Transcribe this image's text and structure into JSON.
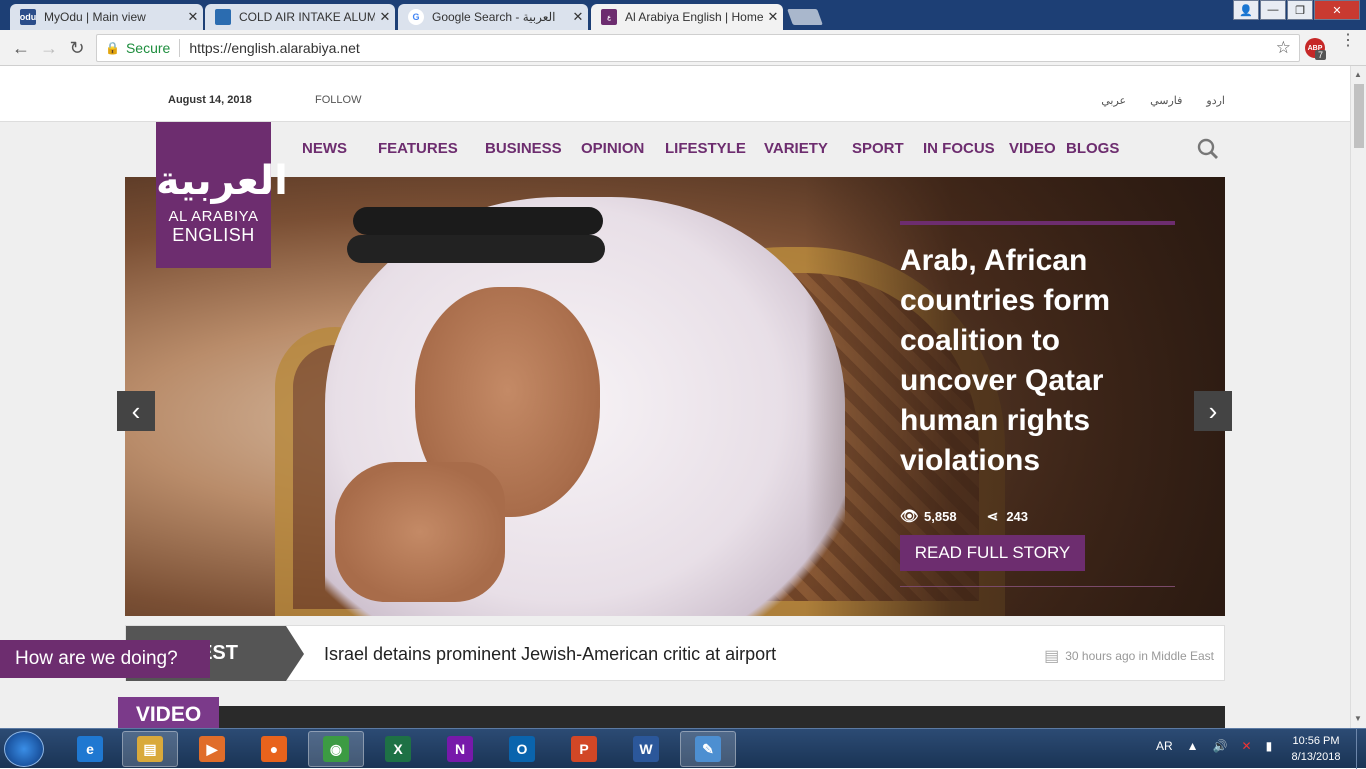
{
  "browser": {
    "tabs": [
      {
        "title": "MyOdu | Main view",
        "favicon": "odu",
        "active": false
      },
      {
        "title": "COLD AIR INTAKE ALUMI",
        "favicon": "store",
        "active": false
      },
      {
        "title": "Google Search - العربية",
        "favicon": "G",
        "active": false
      },
      {
        "title": "Al Arabiya English | Home",
        "favicon": "العربية",
        "active": true
      }
    ],
    "secure_label": "Secure",
    "url": "https://english.alarabiya.net",
    "extension_badge": "7",
    "extension_label": "ABP"
  },
  "site": {
    "date": "August 14, 2018",
    "follow_label": "FOLLOW",
    "languages": [
      "عربي",
      "فارسي",
      "اردو"
    ],
    "logo": {
      "arabic": "العربية",
      "line1": "AL ARABIYA",
      "line2": "ENGLISH"
    },
    "nav": [
      "NEWS",
      "FEATURES",
      "BUSINESS",
      "OPINION",
      "LIFESTYLE",
      "VARIETY",
      "SPORT",
      "IN FOCUS",
      "VIDEO",
      "BLOGS"
    ],
    "hero": {
      "title": "Arab, African countries form coalition to uncover Qatar human rights violations",
      "views": "5,858",
      "shares": "243",
      "cta": "READ FULL STORY",
      "prev_arrow": "‹",
      "next_arrow": "›"
    },
    "latest": {
      "label": "EST",
      "headline": "Israel detains prominent Jewish-American critic at airport",
      "meta": "30 hours ago in Middle East"
    },
    "feedback_label": "How are we doing?",
    "video_label": "VIDEO"
  },
  "taskbar": {
    "apps": [
      {
        "name": "ie",
        "glyph": "e",
        "color": "#1f78d1"
      },
      {
        "name": "explorer",
        "glyph": "▤",
        "color": "#d9a93b"
      },
      {
        "name": "media-player",
        "glyph": "▶",
        "color": "#e06d2a"
      },
      {
        "name": "firefox",
        "glyph": "●",
        "color": "#e8631c"
      },
      {
        "name": "chrome",
        "glyph": "◉",
        "color": "#3c9b43"
      },
      {
        "name": "excel",
        "glyph": "X",
        "color": "#1e7145"
      },
      {
        "name": "onenote",
        "glyph": "N",
        "color": "#7719aa"
      },
      {
        "name": "outlook",
        "glyph": "O",
        "color": "#0a64ad"
      },
      {
        "name": "powerpoint",
        "glyph": "P",
        "color": "#d24726"
      },
      {
        "name": "word",
        "glyph": "W",
        "color": "#2b579a"
      },
      {
        "name": "paint",
        "glyph": "✎",
        "color": "#4d8fd1"
      }
    ],
    "lang": "AR",
    "time": "10:56 PM",
    "date": "8/13/2018"
  },
  "colors": {
    "brand": "#6d2d6f",
    "taskbar": "#1a3455"
  }
}
